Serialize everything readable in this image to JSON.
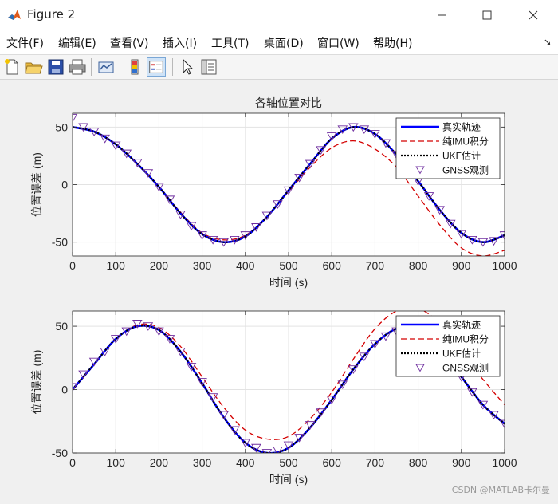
{
  "window": {
    "title": "Figure 2"
  },
  "menu": [
    "文件(F)",
    "编辑(E)",
    "查看(V)",
    "插入(I)",
    "工具(T)",
    "桌面(D)",
    "窗口(W)",
    "帮助(H)"
  ],
  "toolbar_icons": [
    "new-figure-icon",
    "open-file-icon",
    "save-icon",
    "print-icon",
    "link-plot-icon",
    "insert-colorbar-icon",
    "insert-legend-icon",
    "pointer-icon",
    "property-inspector-icon"
  ],
  "watermark": "CSDN @MATLAB卡尔曼",
  "colors": {
    "truth": "#0000ff",
    "imu": "#d40000",
    "ukf": "#000000",
    "gnss": "#7030a0"
  },
  "chart_data": [
    {
      "type": "line",
      "title": "各轴位置对比",
      "xlabel": "时间 (s)",
      "ylabel": "位置误差 (m)",
      "xlim": [
        0,
        1000
      ],
      "ylim": [
        -62,
        62
      ],
      "xticks": [
        0,
        100,
        200,
        300,
        400,
        500,
        600,
        700,
        800,
        900,
        1000
      ],
      "yticks": [
        -50,
        0,
        50
      ],
      "grid": true,
      "legend_position": "top-right",
      "legend": [
        "真实轨迹",
        "纯IMU积分",
        "UKF估计",
        "GNSS观测"
      ],
      "series": [
        {
          "name": "真实轨迹",
          "style": "solid-blue",
          "x": [
            0,
            50,
            100,
            150,
            200,
            250,
            300,
            350,
            400,
            450,
            500,
            550,
            600,
            650,
            700,
            750,
            800,
            850,
            900,
            950,
            1000
          ],
          "y": [
            50,
            46,
            35,
            18,
            -2,
            -25,
            -43,
            -50,
            -45,
            -28,
            -5,
            18,
            40,
            50,
            44,
            26,
            3,
            -22,
            -42,
            -50,
            -44
          ]
        },
        {
          "name": "纯IMU积分",
          "style": "dashed-red",
          "x": [
            0,
            50,
            100,
            150,
            200,
            250,
            300,
            350,
            400,
            450,
            500,
            550,
            600,
            650,
            700,
            750,
            800,
            850,
            900,
            950,
            1000
          ],
          "y": [
            50,
            46,
            35,
            18,
            -2,
            -24,
            -42,
            -48,
            -44,
            -28,
            -6,
            15,
            32,
            38,
            31,
            15,
            -10,
            -35,
            -55,
            -62,
            -57
          ]
        },
        {
          "name": "UKF估计",
          "style": "dotted-black",
          "x": [
            0,
            50,
            100,
            150,
            200,
            250,
            300,
            350,
            400,
            450,
            500,
            550,
            600,
            650,
            700,
            750,
            800,
            850,
            900,
            950,
            1000
          ],
          "y": [
            50,
            46,
            35,
            18,
            -2,
            -25,
            -43,
            -50,
            -45,
            -28,
            -5,
            18,
            40,
            50,
            44,
            26,
            3,
            -22,
            -42,
            -50,
            -44
          ]
        },
        {
          "name": "GNSS观测",
          "style": "triangle-marker",
          "x": [
            0,
            25,
            50,
            75,
            100,
            125,
            150,
            175,
            200,
            225,
            250,
            275,
            300,
            325,
            350,
            375,
            400,
            425,
            450,
            475,
            500,
            525,
            550,
            575,
            600,
            625,
            650,
            675,
            700,
            725,
            750,
            775,
            800,
            825,
            850,
            875,
            900,
            925,
            950,
            975,
            1000
          ],
          "y": [
            58,
            50,
            46,
            40,
            34,
            27,
            19,
            10,
            -2,
            -13,
            -26,
            -36,
            -44,
            -48,
            -50,
            -48,
            -44,
            -37,
            -27,
            -17,
            -5,
            6,
            18,
            30,
            42,
            48,
            50,
            48,
            44,
            36,
            26,
            15,
            3,
            -10,
            -22,
            -34,
            -43,
            -48,
            -50,
            -49,
            -44
          ]
        }
      ]
    },
    {
      "type": "line",
      "xlabel": "时间 (s)",
      "ylabel": "位置误差 (m)",
      "xlim": [
        0,
        1000
      ],
      "ylim": [
        -50,
        62
      ],
      "xticks": [
        0,
        100,
        200,
        300,
        400,
        500,
        600,
        700,
        800,
        900,
        1000
      ],
      "yticks": [
        -50,
        0,
        50
      ],
      "grid": true,
      "legend_position": "top-right",
      "legend": [
        "真实轨迹",
        "纯IMU积分",
        "UKF估计",
        "GNSS观测"
      ],
      "series": [
        {
          "name": "真实轨迹",
          "style": "solid-blue",
          "x": [
            0,
            50,
            100,
            150,
            200,
            250,
            300,
            350,
            400,
            450,
            500,
            550,
            600,
            650,
            700,
            750,
            800,
            850,
            900,
            950,
            1000
          ],
          "y": [
            0,
            20,
            40,
            50,
            47,
            30,
            5,
            -22,
            -42,
            -50,
            -46,
            -30,
            -8,
            16,
            36,
            48,
            47,
            32,
            10,
            -12,
            -27
          ]
        },
        {
          "name": "纯IMU积分",
          "style": "dashed-red",
          "x": [
            0,
            50,
            100,
            150,
            200,
            250,
            300,
            350,
            400,
            450,
            500,
            550,
            600,
            650,
            700,
            750,
            800,
            850,
            900,
            950,
            1000
          ],
          "y": [
            0,
            20,
            40,
            51,
            49,
            34,
            10,
            -14,
            -32,
            -39,
            -37,
            -23,
            -2,
            24,
            48,
            62,
            64,
            52,
            30,
            8,
            -12
          ]
        },
        {
          "name": "UKF估计",
          "style": "dotted-black",
          "x": [
            0,
            50,
            100,
            150,
            200,
            250,
            300,
            350,
            400,
            450,
            500,
            550,
            600,
            650,
            700,
            750,
            800,
            850,
            900,
            950,
            1000
          ],
          "y": [
            0,
            20,
            40,
            50,
            47,
            30,
            5,
            -22,
            -42,
            -50,
            -46,
            -30,
            -8,
            16,
            36,
            48,
            47,
            32,
            10,
            -12,
            -27
          ]
        },
        {
          "name": "GNSS观测",
          "style": "triangle-marker",
          "x": [
            0,
            25,
            50,
            75,
            100,
            125,
            150,
            175,
            200,
            225,
            250,
            275,
            300,
            325,
            350,
            375,
            400,
            425,
            450,
            475,
            500,
            525,
            550,
            575,
            600,
            625,
            650,
            675,
            700,
            725,
            750,
            775,
            800,
            825,
            850,
            875,
            900,
            925,
            950,
            975,
            1000
          ],
          "y": [
            2,
            12,
            22,
            30,
            40,
            46,
            52,
            50,
            46,
            40,
            30,
            18,
            6,
            -6,
            -20,
            -32,
            -42,
            -46,
            -50,
            -48,
            -44,
            -38,
            -28,
            -18,
            -8,
            4,
            16,
            26,
            36,
            42,
            46,
            48,
            46,
            40,
            30,
            20,
            10,
            -2,
            -12,
            -20,
            -27
          ]
        }
      ]
    }
  ]
}
